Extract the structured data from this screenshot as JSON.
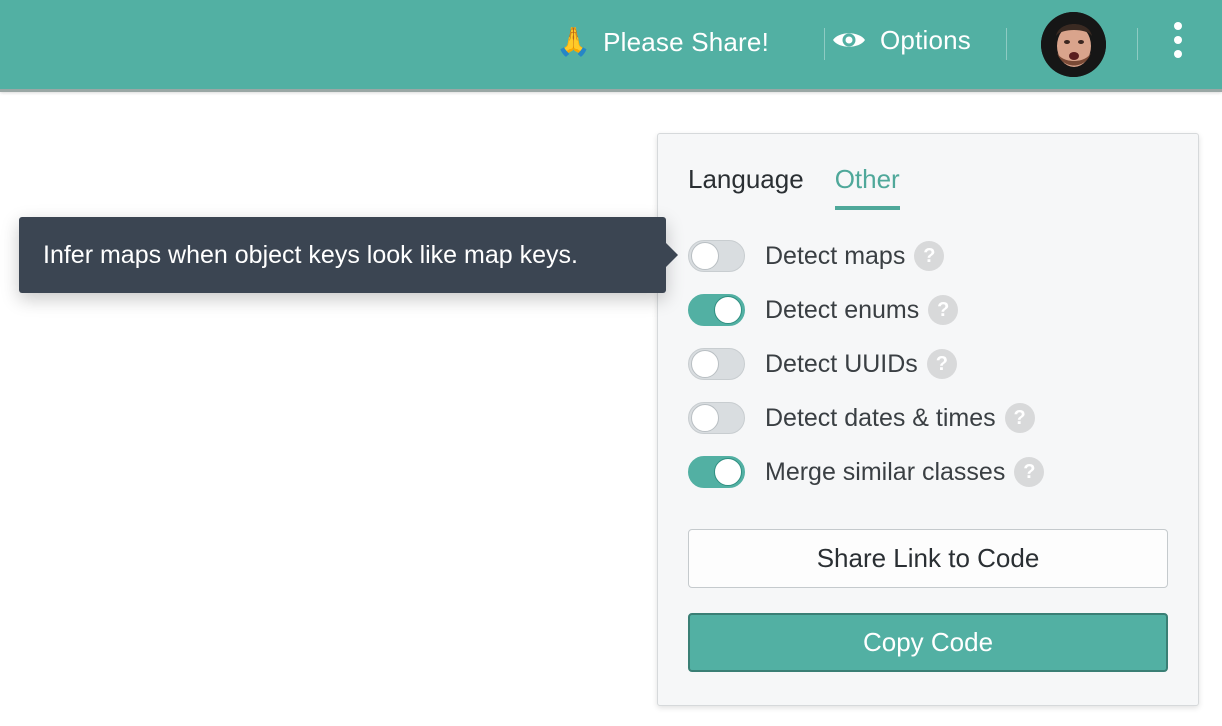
{
  "topbar": {
    "share_label": "Please Share!",
    "share_icon": "🙏",
    "options_label": "Options",
    "bg_color": "#52b0a3"
  },
  "panel": {
    "tabs": [
      {
        "label": "Language",
        "active": false
      },
      {
        "label": "Other",
        "active": true
      }
    ],
    "options": [
      {
        "label": "Detect maps",
        "enabled": false,
        "help": "?"
      },
      {
        "label": "Detect enums",
        "enabled": true,
        "help": "?"
      },
      {
        "label": "Detect UUIDs",
        "enabled": false,
        "help": "?"
      },
      {
        "label": "Detect dates & times",
        "enabled": false,
        "help": "?"
      },
      {
        "label": "Merge similar classes",
        "enabled": true,
        "help": "?"
      }
    ],
    "share_button": "Share Link to Code",
    "copy_button": "Copy Code"
  },
  "tooltip": {
    "text": "Infer maps when object keys look like map keys."
  },
  "colors": {
    "accent": "#52b0a3",
    "tooltip_bg": "#3b4552"
  }
}
